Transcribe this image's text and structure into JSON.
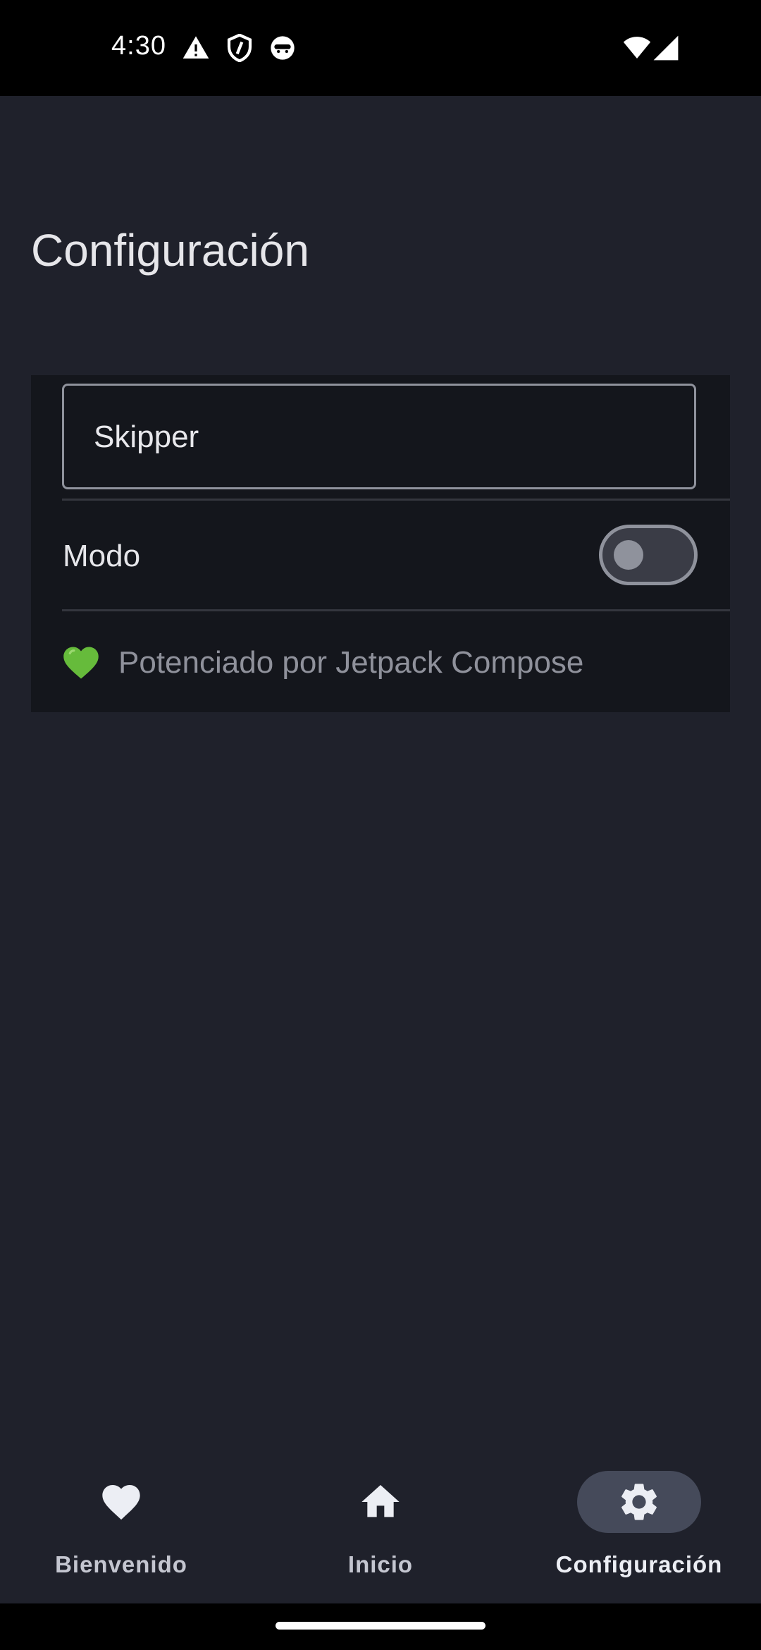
{
  "status_bar": {
    "time": "4:30",
    "left_icons": [
      "warning-icon",
      "shield-icon",
      "face-icon"
    ],
    "right_icons": [
      "wifi-icon",
      "cellular-signal-icon"
    ]
  },
  "page": {
    "title": "Configuración"
  },
  "settings": {
    "name_field_value": "Skipper",
    "mode_label": "Modo",
    "mode_switch_on": false,
    "footer_icon": "green-heart-icon",
    "footer_text": "Potenciado por Jetpack Compose"
  },
  "bottom_nav": {
    "items": [
      {
        "label": "Bienvenido",
        "icon": "heart-icon",
        "active": false
      },
      {
        "label": "Inicio",
        "icon": "home-icon",
        "active": false
      },
      {
        "label": "Configuración",
        "icon": "gear-icon",
        "active": true
      }
    ]
  },
  "colors": {
    "background": "#1f212b",
    "card": "#14161c",
    "active_pill": "#454a5a",
    "footer_heart": "#66bb3b"
  }
}
